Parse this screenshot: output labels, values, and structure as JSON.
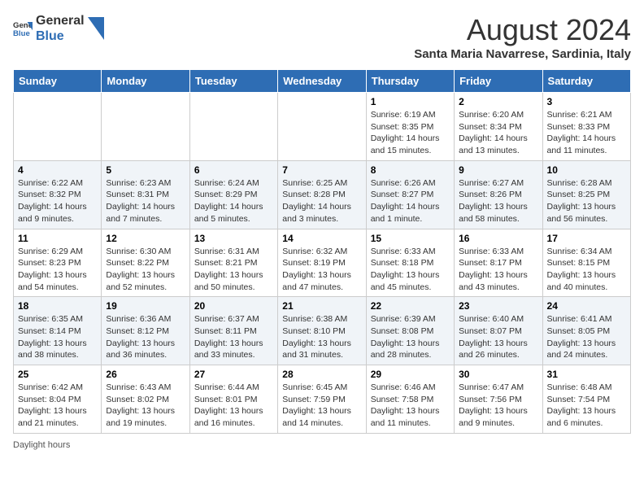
{
  "header": {
    "logo_general": "General",
    "logo_blue": "Blue",
    "month_title": "August 2024",
    "subtitle": "Santa Maria Navarrese, Sardinia, Italy"
  },
  "days_of_week": [
    "Sunday",
    "Monday",
    "Tuesday",
    "Wednesday",
    "Thursday",
    "Friday",
    "Saturday"
  ],
  "weeks": [
    [
      {
        "day": "",
        "info": ""
      },
      {
        "day": "",
        "info": ""
      },
      {
        "day": "",
        "info": ""
      },
      {
        "day": "",
        "info": ""
      },
      {
        "day": "1",
        "info": "Sunrise: 6:19 AM\nSunset: 8:35 PM\nDaylight: 14 hours and 15 minutes."
      },
      {
        "day": "2",
        "info": "Sunrise: 6:20 AM\nSunset: 8:34 PM\nDaylight: 14 hours and 13 minutes."
      },
      {
        "day": "3",
        "info": "Sunrise: 6:21 AM\nSunset: 8:33 PM\nDaylight: 14 hours and 11 minutes."
      }
    ],
    [
      {
        "day": "4",
        "info": "Sunrise: 6:22 AM\nSunset: 8:32 PM\nDaylight: 14 hours and 9 minutes."
      },
      {
        "day": "5",
        "info": "Sunrise: 6:23 AM\nSunset: 8:31 PM\nDaylight: 14 hours and 7 minutes."
      },
      {
        "day": "6",
        "info": "Sunrise: 6:24 AM\nSunset: 8:29 PM\nDaylight: 14 hours and 5 minutes."
      },
      {
        "day": "7",
        "info": "Sunrise: 6:25 AM\nSunset: 8:28 PM\nDaylight: 14 hours and 3 minutes."
      },
      {
        "day": "8",
        "info": "Sunrise: 6:26 AM\nSunset: 8:27 PM\nDaylight: 14 hours and 1 minute."
      },
      {
        "day": "9",
        "info": "Sunrise: 6:27 AM\nSunset: 8:26 PM\nDaylight: 13 hours and 58 minutes."
      },
      {
        "day": "10",
        "info": "Sunrise: 6:28 AM\nSunset: 8:25 PM\nDaylight: 13 hours and 56 minutes."
      }
    ],
    [
      {
        "day": "11",
        "info": "Sunrise: 6:29 AM\nSunset: 8:23 PM\nDaylight: 13 hours and 54 minutes."
      },
      {
        "day": "12",
        "info": "Sunrise: 6:30 AM\nSunset: 8:22 PM\nDaylight: 13 hours and 52 minutes."
      },
      {
        "day": "13",
        "info": "Sunrise: 6:31 AM\nSunset: 8:21 PM\nDaylight: 13 hours and 50 minutes."
      },
      {
        "day": "14",
        "info": "Sunrise: 6:32 AM\nSunset: 8:19 PM\nDaylight: 13 hours and 47 minutes."
      },
      {
        "day": "15",
        "info": "Sunrise: 6:33 AM\nSunset: 8:18 PM\nDaylight: 13 hours and 45 minutes."
      },
      {
        "day": "16",
        "info": "Sunrise: 6:33 AM\nSunset: 8:17 PM\nDaylight: 13 hours and 43 minutes."
      },
      {
        "day": "17",
        "info": "Sunrise: 6:34 AM\nSunset: 8:15 PM\nDaylight: 13 hours and 40 minutes."
      }
    ],
    [
      {
        "day": "18",
        "info": "Sunrise: 6:35 AM\nSunset: 8:14 PM\nDaylight: 13 hours and 38 minutes."
      },
      {
        "day": "19",
        "info": "Sunrise: 6:36 AM\nSunset: 8:12 PM\nDaylight: 13 hours and 36 minutes."
      },
      {
        "day": "20",
        "info": "Sunrise: 6:37 AM\nSunset: 8:11 PM\nDaylight: 13 hours and 33 minutes."
      },
      {
        "day": "21",
        "info": "Sunrise: 6:38 AM\nSunset: 8:10 PM\nDaylight: 13 hours and 31 minutes."
      },
      {
        "day": "22",
        "info": "Sunrise: 6:39 AM\nSunset: 8:08 PM\nDaylight: 13 hours and 28 minutes."
      },
      {
        "day": "23",
        "info": "Sunrise: 6:40 AM\nSunset: 8:07 PM\nDaylight: 13 hours and 26 minutes."
      },
      {
        "day": "24",
        "info": "Sunrise: 6:41 AM\nSunset: 8:05 PM\nDaylight: 13 hours and 24 minutes."
      }
    ],
    [
      {
        "day": "25",
        "info": "Sunrise: 6:42 AM\nSunset: 8:04 PM\nDaylight: 13 hours and 21 minutes."
      },
      {
        "day": "26",
        "info": "Sunrise: 6:43 AM\nSunset: 8:02 PM\nDaylight: 13 hours and 19 minutes."
      },
      {
        "day": "27",
        "info": "Sunrise: 6:44 AM\nSunset: 8:01 PM\nDaylight: 13 hours and 16 minutes."
      },
      {
        "day": "28",
        "info": "Sunrise: 6:45 AM\nSunset: 7:59 PM\nDaylight: 13 hours and 14 minutes."
      },
      {
        "day": "29",
        "info": "Sunrise: 6:46 AM\nSunset: 7:58 PM\nDaylight: 13 hours and 11 minutes."
      },
      {
        "day": "30",
        "info": "Sunrise: 6:47 AM\nSunset: 7:56 PM\nDaylight: 13 hours and 9 minutes."
      },
      {
        "day": "31",
        "info": "Sunrise: 6:48 AM\nSunset: 7:54 PM\nDaylight: 13 hours and 6 minutes."
      }
    ]
  ],
  "footer": "Daylight hours"
}
